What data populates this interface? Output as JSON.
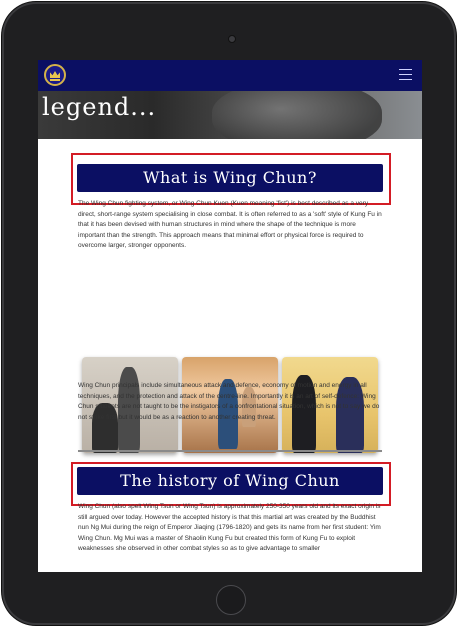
{
  "hero": {
    "title": "legend..."
  },
  "sections": [
    {
      "title": "What is Wing Chun?",
      "paragraphs": [
        "The Wing Chun fighting system, or Wing Chun Kuen (Kuen meaning 'fist') is best described as a very direct, short-range system specialising in close combat. It is often referred to as a 'soft' style of Kung Fu in that it has been devised with human structures in mind where the shape of the technique is more important than the strength. This approach means that minimal effort or physical force is required to overcome larger, stronger opponents.",
        "Wing Chun principals include simultaneous attack and defence, economy of motion and energy in all techniques, and the protection and attack of the centre-line. Importantly it is an art of self-defence: Wing Chun students are not taught to be the instigators of a confrontational situation, which is not to say we do not strike first but it would be as a reaction to another creating threat."
      ]
    },
    {
      "title": "The history of Wing Chun",
      "paragraphs": [
        "Wing Chun (also spelt Wing Tsun or Wing Tsun) is approximately 250-350 years old and its exact origin is still argued over today. However the accepted history is that this martial art was created by the Buddhist nun Ng Mui during the reign of Emperor Jiaqing (1796-1820) and gets its name from her first student: Yim Wing Chun. Mg Mui was a master of Shaolin Kung Fu but created this form of Kung Fu to exploit weaknesses she observed in other combat styles so as to give advantage to smaller"
      ]
    }
  ],
  "colors": {
    "navy": "#0b0f63",
    "highlight": "#d31c25"
  },
  "icons": {
    "logo": "crown-emblem-icon",
    "menu": "hamburger-menu-icon"
  }
}
